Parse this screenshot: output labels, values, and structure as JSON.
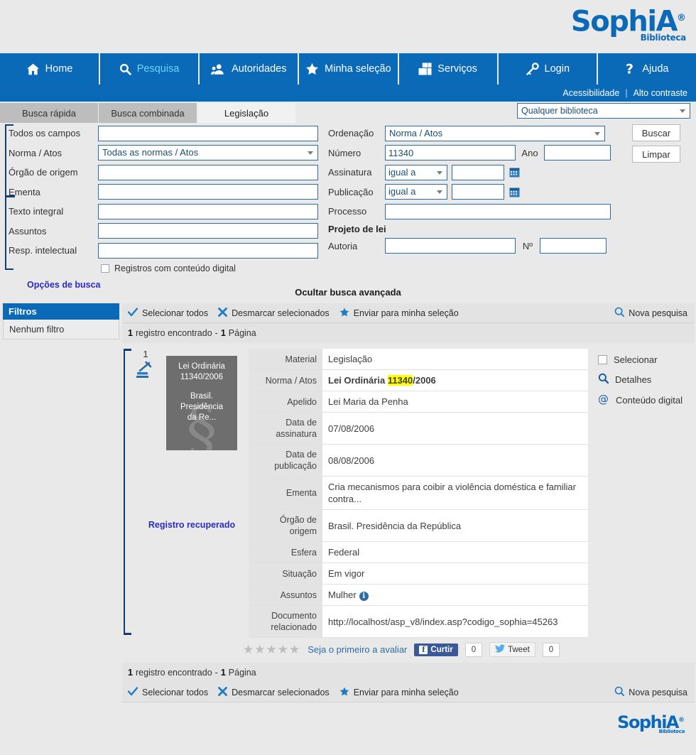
{
  "brand": {
    "name": "SophiA",
    "registered": "®",
    "subtitle": "Biblioteca"
  },
  "nav": {
    "items": [
      {
        "label": "Home",
        "icon": "home-icon",
        "active": false
      },
      {
        "label": "Pesquisa",
        "icon": "search-icon",
        "active": true
      },
      {
        "label": "Autoridades",
        "icon": "users-icon",
        "active": false
      },
      {
        "label": "Minha seleção",
        "icon": "star-icon",
        "active": false
      },
      {
        "label": "Serviços",
        "icon": "windows-icon",
        "active": false
      },
      {
        "label": "Login",
        "icon": "key-icon",
        "active": false
      },
      {
        "label": "Ajuda",
        "icon": "question-icon",
        "active": false
      }
    ]
  },
  "accessibility": {
    "acessibilidade": "Acessibilidade",
    "separator": "|",
    "alto_contraste": "Alto contraste"
  },
  "tabs": [
    {
      "label": "Busca rápida",
      "active": false
    },
    {
      "label": "Busca combinada",
      "active": false
    },
    {
      "label": "Legislação",
      "active": true
    }
  ],
  "library_select": {
    "value": "Qualquer biblioteca"
  },
  "search_form": {
    "left_fields": [
      {
        "label": "Todos os campos",
        "type": "input",
        "value": "",
        "placeholder": ""
      },
      {
        "label": "Norma / Atos",
        "type": "select",
        "value": "Todas as normas / Atos"
      },
      {
        "label": "Órgão de origem",
        "type": "input",
        "value": "",
        "placeholder": ""
      },
      {
        "label": "Ementa",
        "type": "input",
        "value": "",
        "placeholder": ""
      },
      {
        "label": "Texto integral",
        "type": "input",
        "value": "",
        "placeholder": ""
      },
      {
        "label": "Assuntos",
        "type": "input",
        "value": "",
        "placeholder": ""
      },
      {
        "label": "Resp. intelectual",
        "type": "input",
        "value": "",
        "placeholder": ""
      }
    ],
    "digital_checkbox": {
      "label": "Registros com conteúdo digital",
      "checked": false
    },
    "options_link": "Opções de busca",
    "ordenacao": {
      "label": "Ordenação",
      "value": "Norma / Atos"
    },
    "numero": {
      "label": "Número",
      "value": "11340"
    },
    "ano": {
      "label": "Ano",
      "value": ""
    },
    "assinatura": {
      "label": "Assinatura",
      "operator": "igual a",
      "value": ""
    },
    "publicacao": {
      "label": "Publicação",
      "operator": "igual a",
      "value": ""
    },
    "processo": {
      "label": "Processo",
      "value": ""
    },
    "projeto_de_lei": {
      "title": "Projeto de lei",
      "autoria_label": "Autoria",
      "autoria_value": "",
      "numero_label": "Nº",
      "numero_value": ""
    },
    "buttons": {
      "buscar": "Buscar",
      "limpar": "Limpar"
    },
    "hide_advanced": "Ocultar busca avançada"
  },
  "filters": {
    "title": "Filtros",
    "empty": "Nenhum filtro"
  },
  "actions": {
    "select_all": "Selecionar todos",
    "deselect": "Desmarcar selecionados",
    "send_selection": "Enviar para minha seleção",
    "new_search": "Nova pesquisa"
  },
  "results_summary": {
    "count": "1",
    "count_label": "registro encontrado",
    "dash": "-",
    "pages": "1",
    "pages_label": "Página"
  },
  "record": {
    "index": "1",
    "cover_line1": "Lei Ordinária",
    "cover_line2": "11340/2006",
    "cover_line3": "Brasil. Presidência",
    "cover_line4": "da Re...",
    "cover_watermark": "§",
    "recovered_label": "Registro recuperado",
    "fields": [
      {
        "key": "Material",
        "value": "Legislação",
        "style": "plain"
      },
      {
        "key": "Norma / Atos",
        "value": "Lei Ordinária 11340/2006",
        "style": "bold-highlight",
        "prefix": "Lei Ordinária ",
        "highlight": "11340",
        "suffix": "/2006"
      },
      {
        "key": "Apelido",
        "value": "Lei Maria da Penha",
        "style": "plain"
      },
      {
        "key": "Data de assinatura",
        "value": "07/08/2006",
        "style": "plain"
      },
      {
        "key": "Data de publicação",
        "value": "08/08/2006",
        "style": "plain"
      },
      {
        "key": "Ementa",
        "value": "Cria mecanismos para coibir a violência doméstica e familiar contra...",
        "style": "plain"
      },
      {
        "key": "Órgão de origem",
        "value": "Brasil. Presidência da República",
        "style": "link"
      },
      {
        "key": "Esfera",
        "value": "Federal",
        "style": "plain"
      },
      {
        "key": "Situação",
        "value": "Em vigor",
        "style": "plain"
      },
      {
        "key": "Assuntos",
        "value": "Mulher",
        "style": "link-info"
      },
      {
        "key": "Documento relacionado",
        "value": "http://localhost/asp_v8/index.asp?codigo_sophia=45263",
        "style": "link"
      }
    ],
    "side_actions": [
      {
        "label": "Selecionar",
        "icon": "checkbox-icon"
      },
      {
        "label": "Detalhes",
        "icon": "magnifier-icon"
      },
      {
        "label": "Conteúdo digital",
        "icon": "at-icon"
      }
    ],
    "social": {
      "rate_text": "Seja o primeiro a avaliar",
      "stars": 5,
      "facebook_label": "Curtir",
      "facebook_count": "0",
      "twitter_label": "Tweet",
      "twitter_count": "0"
    }
  },
  "colors": {
    "brand_blue": "#0b6ab8",
    "active_tab_cyan": "#6fd6f5",
    "highlight_yellow": "#ffff00",
    "link_blue": "#2b2bbf",
    "facebook_blue": "#3b5998",
    "twitter_blue": "#55acee"
  }
}
